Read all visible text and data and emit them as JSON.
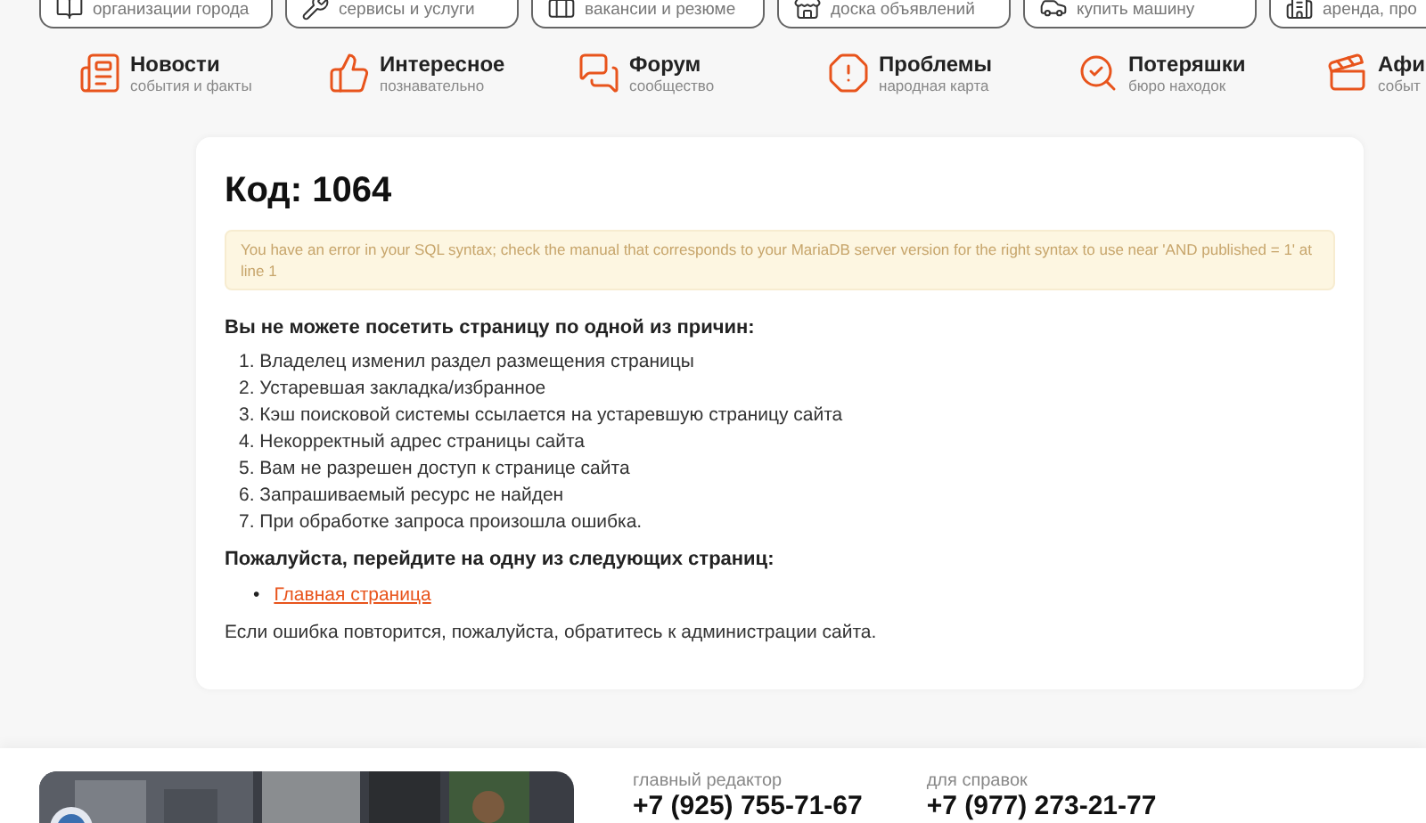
{
  "top_cards": [
    {
      "subtitle": "организации города"
    },
    {
      "subtitle": "сервисы и услуги"
    },
    {
      "subtitle": "вакансии и резюме"
    },
    {
      "subtitle": "доска объявлений"
    },
    {
      "subtitle": "купить машину"
    },
    {
      "subtitle": "аренда, про"
    }
  ],
  "nav": [
    {
      "title": "Новости",
      "subtitle": "события и факты"
    },
    {
      "title": "Интересное",
      "subtitle": "познавательно"
    },
    {
      "title": "Форум",
      "subtitle": "сообщество"
    },
    {
      "title": "Проблемы",
      "subtitle": "народная карта"
    },
    {
      "title": "Потеряшки",
      "subtitle": "бюро находок"
    },
    {
      "title": "Афи",
      "subtitle": "событ"
    }
  ],
  "error": {
    "title": "Код: 1064",
    "message": "You have an error in your SQL syntax; check the manual that corresponds to your MariaDB server version for the right syntax to use near 'AND published = 1' at line 1",
    "reasons_heading": "Вы не можете посетить страницу по одной из причин:",
    "reasons": [
      "1. Владелец изменил раздел размещения страницы",
      "2. Устаревшая закладка/избранное",
      "3. Кэш поисковой системы ссылается на устаревшую страницу сайта",
      "4. Некорректный адрес страницы сайта",
      "5. Вам не разрешен доступ к странице сайта",
      "6. Запрашиваемый ресурс не найден",
      "7. При обработке запроса произошла ошибка."
    ],
    "pages_heading": "Пожалуйста, перейдите на одну из следующих страниц:",
    "links": [
      {
        "bullet": "•",
        "label": "Главная страница"
      }
    ],
    "note": "Если ошибка повторится, пожалуйста, обратитесь к администрации сайта."
  },
  "footer": {
    "contacts": [
      {
        "label": "главный редактор",
        "phone": "+7 (925) 755-71-67"
      },
      {
        "label": "для справок",
        "phone": "+7 (977) 273-21-77"
      }
    ]
  }
}
